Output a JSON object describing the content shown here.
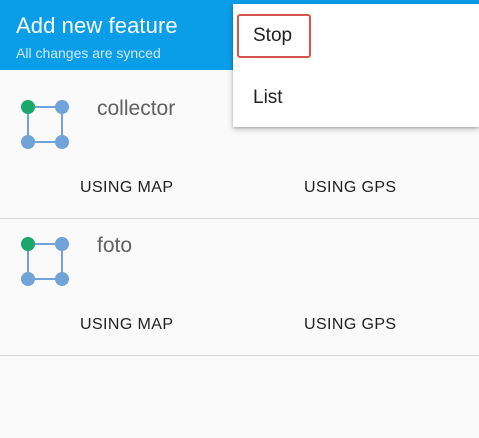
{
  "app_bar": {
    "title": "Add new feature",
    "subtitle": "All changes are synced",
    "background": "#0a9de8"
  },
  "layers": [
    {
      "name": "collector",
      "icon": "polygon-layer-icon",
      "actions": {
        "map_label": "USING MAP",
        "gps_label": "USING GPS"
      }
    },
    {
      "name": "foto",
      "icon": "polygon-layer-icon",
      "actions": {
        "map_label": "USING MAP",
        "gps_label": "USING GPS"
      }
    }
  ],
  "menu": {
    "items": [
      {
        "label": "Stop",
        "highlighted": true
      },
      {
        "label": "List",
        "highlighted": false
      }
    ],
    "highlight_color": "#d9534f"
  },
  "colors": {
    "vertex_active": "#1aa86a",
    "vertex": "#6fa3d9"
  }
}
